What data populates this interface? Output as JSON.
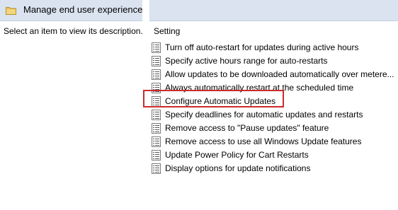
{
  "header": {
    "title": "Manage end user experience",
    "icon": "folder-icon"
  },
  "description_pane": {
    "text": "Select an item to view its description."
  },
  "settings": {
    "column_header": "Setting",
    "items": [
      {
        "label": "Turn off auto-restart for updates during active hours",
        "icon": "policy-setting-icon"
      },
      {
        "label": "Specify active hours range for auto-restarts",
        "icon": "policy-setting-icon"
      },
      {
        "label": "Allow updates to be downloaded automatically over metere...",
        "icon": "policy-setting-icon"
      },
      {
        "label": "Always automatically restart at the scheduled time",
        "icon": "policy-setting-icon"
      },
      {
        "label": "Configure Automatic Updates",
        "icon": "policy-setting-icon",
        "highlighted": true
      },
      {
        "label": "Specify deadlines for automatic updates and restarts",
        "icon": "policy-setting-icon"
      },
      {
        "label": "Remove access to \"Pause updates\" feature",
        "icon": "policy-setting-icon"
      },
      {
        "label": "Remove access to use all Windows Update features",
        "icon": "policy-setting-icon"
      },
      {
        "label": "Update Power Policy for Cart Restarts",
        "icon": "policy-setting-icon"
      },
      {
        "label": "Display options for update notifications",
        "icon": "policy-setting-icon"
      }
    ]
  },
  "colors": {
    "header_background": "#dae3ef",
    "highlight_border": "#cc2b2b",
    "folder": "#e8c15a"
  }
}
